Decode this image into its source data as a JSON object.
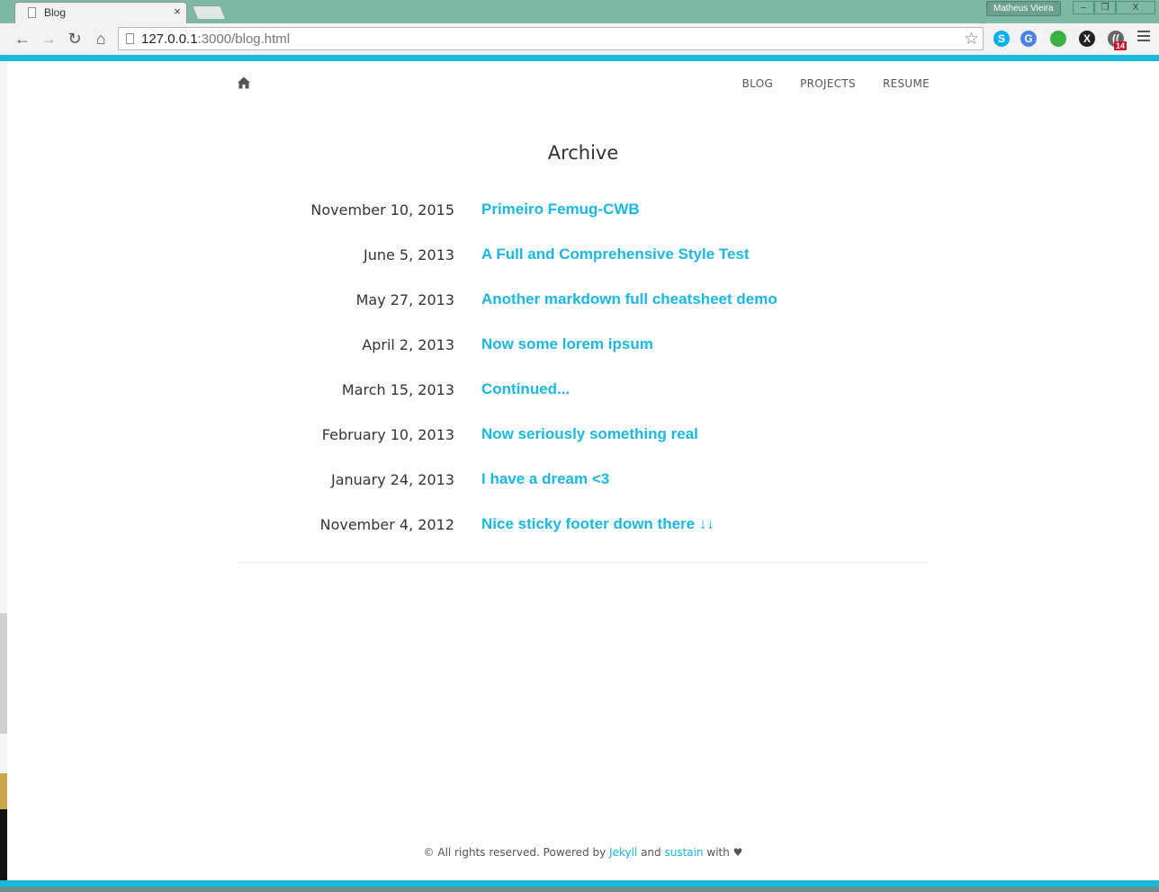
{
  "browser": {
    "tab_title": "Blog",
    "tab_close": "×",
    "user_name": "Matheus Vieira",
    "url_host": "127.0.0.1",
    "url_path": ":3000/blog.html",
    "controls": {
      "minimize": "–",
      "restore": "❐",
      "close": "X"
    },
    "nav": {
      "back": "←",
      "forward": "→",
      "reload": "↻",
      "home": "⌂"
    },
    "star": "☆",
    "extension_badge": "14",
    "extensions": [
      {
        "name": "skype-icon",
        "color": "#00aff0",
        "glyph": "S"
      },
      {
        "name": "translate-icon",
        "color": "#4a84e8",
        "glyph": "G"
      },
      {
        "name": "green-circle-icon",
        "color": "#3cb043",
        "glyph": ""
      },
      {
        "name": "x-extension-icon",
        "color": "#222222",
        "glyph": "X"
      },
      {
        "name": "feed-icon",
        "color": "#666666",
        "glyph": "(("
      }
    ]
  },
  "site": {
    "nav": [
      "BLOG",
      "PROJECTS",
      "RESUME"
    ],
    "archive_title": "Archive",
    "posts": [
      {
        "date": "November 10, 2015",
        "title": "Primeiro Femug-CWB"
      },
      {
        "date": "June 5, 2013",
        "title": "A Full and Comprehensive Style Test"
      },
      {
        "date": "May 27, 2013",
        "title": "Another markdown full cheatsheet demo"
      },
      {
        "date": "April 2, 2013",
        "title": "Now some lorem ipsum"
      },
      {
        "date": "March 15, 2013",
        "title": "Continued..."
      },
      {
        "date": "February 10, 2013",
        "title": "Now seriously something real"
      },
      {
        "date": "January 24, 2013",
        "title": "I have a dream <3"
      },
      {
        "date": "November 4, 2012",
        "title": "Nice sticky footer down there ↓↓"
      }
    ],
    "footer": {
      "prefix": "© All rights reserved. Powered by ",
      "jekyll": "Jekyll",
      "and": " and ",
      "sustain": "sustain",
      "suffix": " with ♥"
    }
  },
  "colors": {
    "accent": "#1ab8e0",
    "chrome": "#7fb9a4"
  }
}
